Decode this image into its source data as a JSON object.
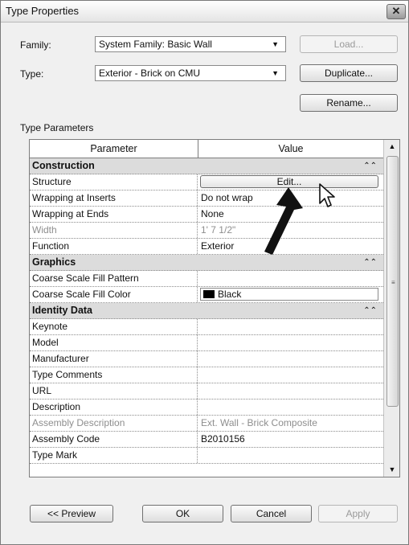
{
  "window": {
    "title": "Type Properties",
    "close": "✕"
  },
  "family": {
    "label": "Family:",
    "value": "System Family: Basic Wall"
  },
  "type": {
    "label": "Type:",
    "value": "Exterior - Brick on CMU"
  },
  "buttons": {
    "load": "Load...",
    "duplicate": "Duplicate...",
    "rename": "Rename...",
    "preview": "<< Preview",
    "ok": "OK",
    "cancel": "Cancel",
    "apply": "Apply"
  },
  "type_parameters_label": "Type Parameters",
  "grid": {
    "header_parameter": "Parameter",
    "header_value": "Value",
    "groups": {
      "construction": "Construction",
      "graphics": "Graphics",
      "identity": "Identity Data"
    },
    "rows": {
      "structure": {
        "param": "Structure",
        "value": "Edit..."
      },
      "wrap_inserts": {
        "param": "Wrapping at Inserts",
        "value": "Do not wrap"
      },
      "wrap_ends": {
        "param": "Wrapping at Ends",
        "value": "None"
      },
      "width": {
        "param": "Width",
        "value": "1'  7 1/2\""
      },
      "function": {
        "param": "Function",
        "value": "Exterior"
      },
      "fill_pattern": {
        "param": "Coarse Scale Fill Pattern",
        "value": ""
      },
      "fill_color": {
        "param": "Coarse Scale Fill Color",
        "value": "Black"
      },
      "keynote": {
        "param": "Keynote",
        "value": ""
      },
      "model": {
        "param": "Model",
        "value": ""
      },
      "manufacturer": {
        "param": "Manufacturer",
        "value": ""
      },
      "type_comments": {
        "param": "Type Comments",
        "value": ""
      },
      "url": {
        "param": "URL",
        "value": ""
      },
      "description": {
        "param": "Description",
        "value": ""
      },
      "assembly_description": {
        "param": "Assembly Description",
        "value": "Ext. Wall - Brick Composite"
      },
      "assembly_code": {
        "param": "Assembly Code",
        "value": "B2010156"
      },
      "type_mark": {
        "param": "Type Mark",
        "value": ""
      }
    }
  },
  "icons": {
    "dropdown": "chevron-down-icon",
    "collapse": "collapse-icon",
    "cursor": "mouse-pointer-icon",
    "annotation_arrow": "arrow-annotation-icon"
  }
}
